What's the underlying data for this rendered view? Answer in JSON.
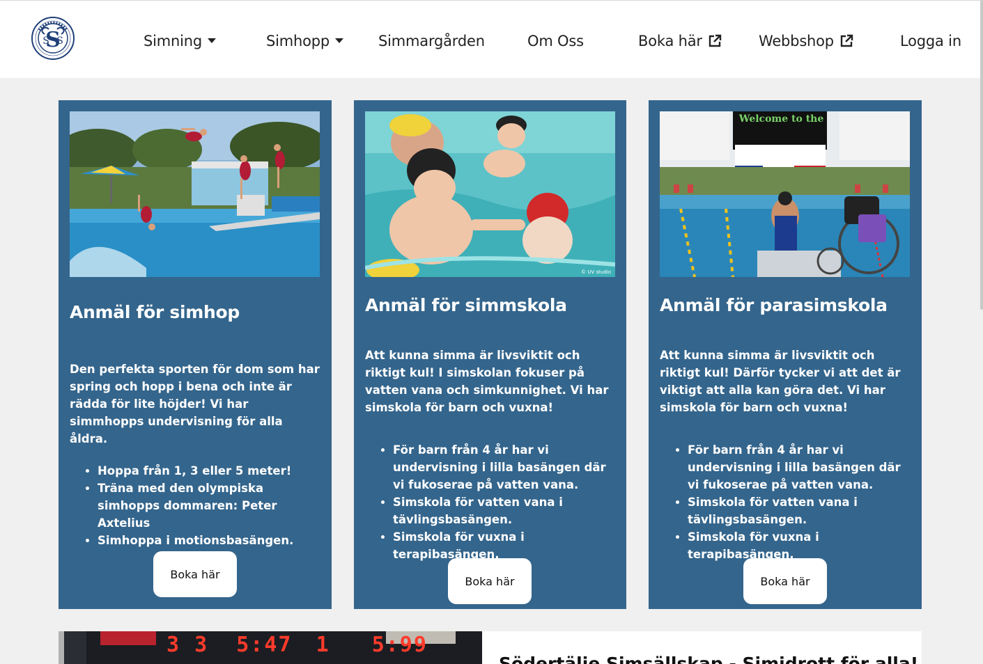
{
  "header": {
    "logo_alt": "Södertälje Simsällskap",
    "nav": [
      {
        "label": "Simning",
        "icon": "caret-down-icon"
      },
      {
        "label": "Simhopp",
        "icon": "caret-down-icon"
      },
      {
        "label": "Simmargården"
      },
      {
        "label": "Om Oss"
      },
      {
        "label": "Boka här",
        "icon": "external-link-icon"
      },
      {
        "label": "Webbshop",
        "icon": "external-link-icon"
      },
      {
        "label": "Logga in"
      }
    ]
  },
  "cards": [
    {
      "title": "Anmäl för simhop",
      "text": "Den perfekta sporten för dom som har spring och hopp i bena och inte är rädda för lite höjder! Vi har simmhopps undervisning för alla åldra.",
      "bullets": [
        "Hoppa från 1, 3 eller 5 meter!",
        "Träna med den olympiska simhopps dommaren: Peter Axtelius",
        "Simhoppa i motionsbasängen."
      ],
      "button": "Boka här"
    },
    {
      "title": "Anmäl för simmskola",
      "text": "Att kunna simma är livsviktit och riktigt kul! I simskolan fokuser på vatten vana och simkunnighet. Vi har simskola för barn och vuxna!",
      "bullets": [
        "För barn från 4 år har vi undervisning i lilla basängen där vi fukoserae på vatten vana.",
        "Simskola för vatten vana i tävlingsbasängen.",
        "Simskola för vuxna i terapibasängen."
      ],
      "button": "Boka här",
      "photo_credit": "© UV studio"
    },
    {
      "title": "Anmäl för parasimskola",
      "text": "Att kunna simma är livsviktit och riktigt kul! Därför tycker vi att det är viktigt att alla kan göra det. Vi har simskola för barn och vuxna!",
      "bullets": [
        "För barn från 4 år har vi undervisning i lilla basängen där vi fukoserae på vatten vana.",
        "Simskola för vatten vana i tävlingsbasängen.",
        "Simskola för vuxna i terapibasängen."
      ],
      "button": "Boka här",
      "photo_sign": "Welcome to the"
    }
  ],
  "scoreboard": [
    "3",
    "3",
    "5:47",
    "1",
    "5:99"
  ],
  "bottom": {
    "heading": "Södertälje Simsällskap - Simidrott för alla!"
  },
  "colors": {
    "card_bg": "#34658c",
    "page_bg": "#f0f0f0",
    "header_bg": "#ffffff"
  }
}
